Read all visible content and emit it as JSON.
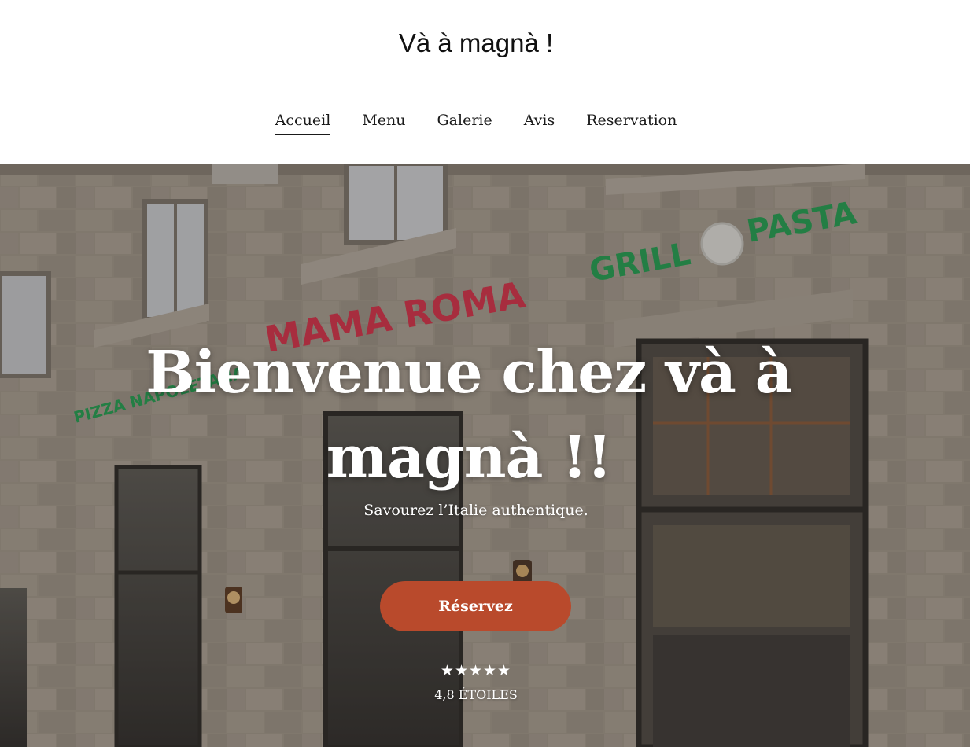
{
  "header": {
    "site_title": "Và à magnà !",
    "nav": [
      {
        "label": "Accueil",
        "active": true
      },
      {
        "label": "Menu",
        "active": false
      },
      {
        "label": "Galerie",
        "active": false
      },
      {
        "label": "Avis",
        "active": false
      },
      {
        "label": "Reservation",
        "active": false
      }
    ]
  },
  "hero": {
    "title": "Bienvenue chez và à magnà !!",
    "subtitle": "Savourez l’Italie authentique.",
    "cta_label": "Réservez",
    "stars": "★★★★★",
    "rating_text": "4,8 ÉTOILES",
    "signs": {
      "sign1": "MAMA ROMA",
      "sign2": "PIZZA NAPOLETANA",
      "sign3_left": "GRILL",
      "sign3_right": "PASTA"
    }
  },
  "colors": {
    "cta": "#b94a2c",
    "sign_red": "#d8324b",
    "sign_green": "#22a354",
    "stone": "#a69d90"
  }
}
